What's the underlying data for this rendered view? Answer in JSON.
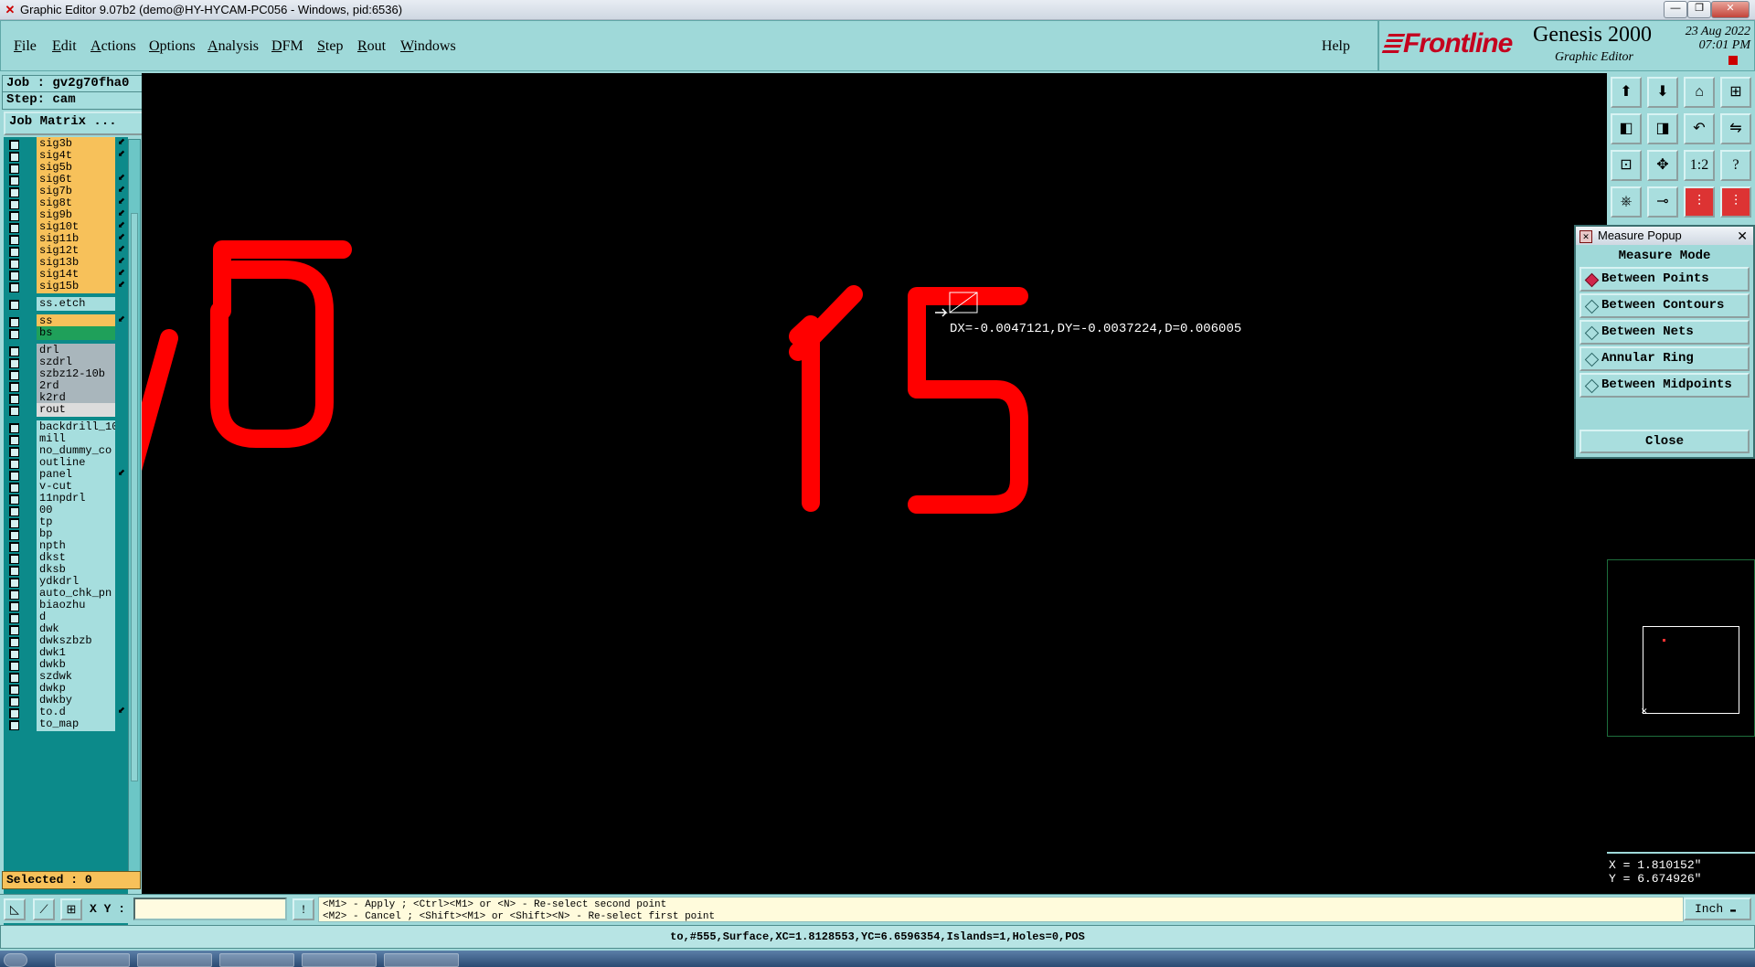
{
  "window": {
    "title": "Graphic Editor 9.07b2 (demo@HY-HYCAM-PC056 - Windows, pid:6536)",
    "controls": [
      "—",
      "❐",
      "✕"
    ]
  },
  "menu": {
    "items": [
      "File",
      "Edit",
      "Actions",
      "Options",
      "Analysis",
      "DFM",
      "Step",
      "Rout",
      "Windows"
    ],
    "help": "Help"
  },
  "brand": {
    "logo": "Frontline",
    "product": "Genesis 2000",
    "subtitle": "Graphic Editor",
    "date": "23 Aug 2022",
    "time": "07:01 PM"
  },
  "left": {
    "job": "Job : gv2g70fha0",
    "step": "Step: cam",
    "job_matrix": "Job Matrix ...",
    "selected": "Selected : 0"
  },
  "layers": [
    {
      "name": "sig3b",
      "color": "#f7c15a",
      "arrow": true
    },
    {
      "name": "sig4t",
      "color": "#f7c15a",
      "arrow": true
    },
    {
      "name": "sig5b",
      "color": "#f7c15a",
      "arrow": false
    },
    {
      "name": "sig6t",
      "color": "#f7c15a",
      "arrow": true
    },
    {
      "name": "sig7b",
      "color": "#f7c15a",
      "arrow": true
    },
    {
      "name": "sig8t",
      "color": "#f7c15a",
      "arrow": true
    },
    {
      "name": "sig9b",
      "color": "#f7c15a",
      "arrow": true
    },
    {
      "name": "sig10t",
      "color": "#f7c15a",
      "arrow": true
    },
    {
      "name": "sig11b",
      "color": "#f7c15a",
      "arrow": true
    },
    {
      "name": "sig12t",
      "color": "#f7c15a",
      "arrow": true
    },
    {
      "name": "sig13b",
      "color": "#f7c15a",
      "arrow": true
    },
    {
      "name": "sig14t",
      "color": "#f7c15a",
      "arrow": true
    },
    {
      "name": "sig15b",
      "color": "#f7c15a",
      "arrow": true
    },
    {
      "gap": true
    },
    {
      "name": "ss.etch",
      "color": "#a6dede",
      "arrow": false
    },
    {
      "gap": true
    },
    {
      "name": "ss",
      "color": "#f7c15a",
      "arrow": true
    },
    {
      "name": "bs",
      "color": "#1fa05a",
      "arrow": false
    },
    {
      "gap": true
    },
    {
      "name": "drl",
      "color": "#a9b6bc",
      "arrow": false
    },
    {
      "name": "szdrl",
      "color": "#a9b6bc",
      "arrow": false
    },
    {
      "name": "szbz12-10b",
      "color": "#a9b6bc",
      "arrow": false
    },
    {
      "name": "2rd",
      "color": "#a9b6bc",
      "arrow": false
    },
    {
      "name": "k2rd",
      "color": "#a9b6bc",
      "arrow": false
    },
    {
      "name": "rout",
      "color": "#dcdcdc",
      "arrow": false
    },
    {
      "gap": true
    },
    {
      "name": "backdrill_10",
      "color": "#a6dede",
      "arrow": false
    },
    {
      "name": "mill",
      "color": "#a6dede",
      "arrow": false
    },
    {
      "name": "no_dummy_co",
      "color": "#a6dede",
      "arrow": false
    },
    {
      "name": "outline",
      "color": "#a6dede",
      "arrow": false
    },
    {
      "name": "panel",
      "color": "#a6dede",
      "arrow": true
    },
    {
      "name": "v-cut",
      "color": "#a6dede",
      "arrow": false
    },
    {
      "name": "11npdrl",
      "color": "#a6dede",
      "arrow": false
    },
    {
      "name": "00",
      "color": "#a6dede",
      "arrow": false
    },
    {
      "name": "tp",
      "color": "#a6dede",
      "arrow": false
    },
    {
      "name": "bp",
      "color": "#a6dede",
      "arrow": false
    },
    {
      "name": "npth",
      "color": "#a6dede",
      "arrow": false
    },
    {
      "name": "dkst",
      "color": "#a6dede",
      "arrow": false
    },
    {
      "name": "dksb",
      "color": "#a6dede",
      "arrow": false
    },
    {
      "name": "ydkdrl",
      "color": "#a6dede",
      "arrow": false
    },
    {
      "name": "auto_chk_pn",
      "color": "#a6dede",
      "arrow": false
    },
    {
      "name": "biaozhu",
      "color": "#a6dede",
      "arrow": false
    },
    {
      "name": "d",
      "color": "#a6dede",
      "arrow": false
    },
    {
      "name": "dwk",
      "color": "#a6dede",
      "arrow": false
    },
    {
      "name": "dwkszbzb",
      "color": "#a6dede",
      "arrow": false
    },
    {
      "name": "dwk1",
      "color": "#a6dede",
      "arrow": false
    },
    {
      "name": "dwkb",
      "color": "#a6dede",
      "arrow": false
    },
    {
      "name": "szdwk",
      "color": "#a6dede",
      "arrow": false
    },
    {
      "name": "dwkp",
      "color": "#a6dede",
      "arrow": false
    },
    {
      "name": "dwkby",
      "color": "#a6dede",
      "arrow": false
    },
    {
      "name": "to.d",
      "color": "#a6dede",
      "arrow": true
    },
    {
      "name": "to_map",
      "color": "#a6dede",
      "arrow": false
    }
  ],
  "canvas": {
    "measure_text": "DX=-0.0047121,DY=-0.0037224,D=0.006005",
    "glyph_color": "#ff0000",
    "left_text": "/5",
    "center_text": "15"
  },
  "toolbar_icons": [
    "open-icon",
    "save-icon",
    "home-icon",
    "grid-icon",
    "prev-icon",
    "next-icon",
    "undo-icon",
    "route-icon",
    "fit-icon",
    "center-icon",
    "scale-icon",
    "help-icon",
    "hat-icon",
    "cursor-icon",
    "layers-red-icon",
    "layers-red2-icon"
  ],
  "toolbar_glyphs": [
    "⬆",
    "⬇",
    "⌂",
    "⊞",
    "◧",
    "◨",
    "↶",
    "⇋",
    "⊡",
    "✥",
    "1:2",
    "?",
    "⎈",
    "⊸",
    "⫶",
    "⫶"
  ],
  "measure_popup": {
    "title": "Measure Popup",
    "mode_label": "Measure Mode",
    "options": [
      {
        "label": "Between Points",
        "selected": true
      },
      {
        "label": "Between Contours",
        "selected": false
      },
      {
        "label": "Between Nets",
        "selected": false
      },
      {
        "label": "Annular Ring",
        "selected": false
      },
      {
        "label": "Between Midpoints",
        "selected": false
      }
    ],
    "close": "Close"
  },
  "coords": {
    "x": "X = 1.810152\"",
    "y": "Y = 6.674926\""
  },
  "bottom": {
    "xy_label": "X Y :",
    "xy_value": "",
    "hint_line1": "<M1> - Apply  ; <Ctrl><M1> or <N> - Re-select second point",
    "hint_line2": "<M2> - Cancel ; <Shift><M1> or <Shift><N> - Re-select first point",
    "unit": "Inch"
  },
  "status": "to,#555,Surface,XC=1.8128553,YC=6.6596354,Islands=1,Holes=0,POS"
}
